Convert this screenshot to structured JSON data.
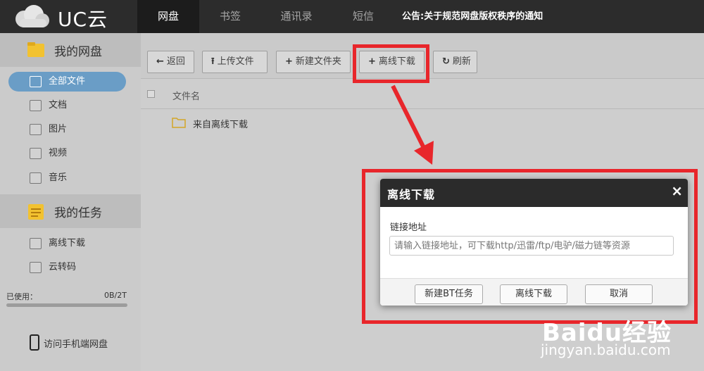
{
  "app": {
    "brand": "UC云"
  },
  "nav": {
    "tabs": [
      {
        "label": "网盘",
        "active": true
      },
      {
        "label": "书签",
        "active": false
      },
      {
        "label": "通讯录",
        "active": false
      },
      {
        "label": "短信",
        "active": false
      }
    ],
    "notice": "公告:关于规范网盘版权秩序的通知"
  },
  "sidebar": {
    "my_disk": "我的网盘",
    "disk_items": [
      {
        "label": "全部文件",
        "icon": "list-icon",
        "active": true
      },
      {
        "label": "文档",
        "icon": "document-icon"
      },
      {
        "label": "图片",
        "icon": "image-icon"
      },
      {
        "label": "视频",
        "icon": "video-icon"
      },
      {
        "label": "音乐",
        "icon": "music-icon"
      }
    ],
    "my_tasks": "我的任务",
    "task_items": [
      {
        "label": "离线下载",
        "icon": "list-icon"
      },
      {
        "label": "云转码",
        "icon": "list-icon"
      }
    ],
    "usage_label": "已使用：",
    "usage_value": "0B/2T",
    "usage_fraction": 0.0,
    "mobile_link": "访问手机端网盘"
  },
  "toolbar": {
    "back": "返回",
    "upload": "上传文件",
    "new_folder": "新建文件夹",
    "offline_download": "离线下载",
    "refresh": "刷新"
  },
  "file_list": {
    "column_name": "文件名",
    "rows": [
      {
        "name": "来自离线下载",
        "icon": "folder-icon"
      }
    ]
  },
  "dialog": {
    "title": "离线下载",
    "close": "×",
    "url_label": "链接地址",
    "url_placeholder": "请输入链接地址，可下载http/迅雷/ftp/电驴/磁力链等资源",
    "url_value": "",
    "bt_button": "新建BT任务",
    "download_button": "离线下载",
    "cancel_button": "取消"
  },
  "watermark": {
    "logo": "Baidu经验",
    "url": "jingyan.baidu.com"
  },
  "colors": {
    "topbar": "#2c2c2c",
    "highlight": "#e8262b",
    "active_item": "#6a9dc6"
  }
}
